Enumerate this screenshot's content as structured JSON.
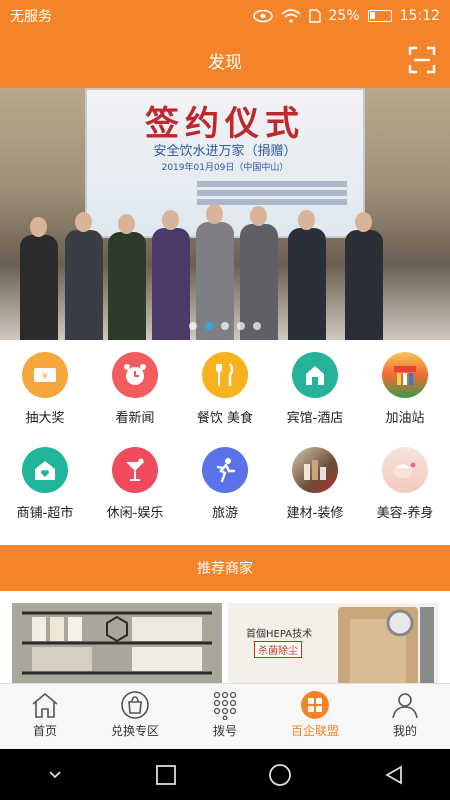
{
  "status_bar": {
    "carrier": "无服务",
    "battery": "25%",
    "time": "15:12"
  },
  "header": {
    "title": "发现"
  },
  "banner": {
    "title": "签约仪式",
    "subtitle": "安全饮水进万家（捐赠）",
    "date": "2019年01月09日（中国中山）",
    "slide_count": 5,
    "active_slide": 1
  },
  "categories": [
    {
      "label": "抽大奖",
      "icon": "ticket-icon",
      "color": "#f5a63c"
    },
    {
      "label": "看新闻",
      "icon": "alarm-clock-icon",
      "color": "#f25c5c"
    },
    {
      "label": "餐饮 美食",
      "icon": "fork-knife-icon",
      "color": "#f7b21d"
    },
    {
      "label": "宾馆-酒店",
      "icon": "hotel-building-icon",
      "color": "#26b39a"
    },
    {
      "label": "加油站",
      "icon": "gas-station-photo-icon",
      "color": "#f06a2f"
    },
    {
      "label": "商铺-超市",
      "icon": "store-house-icon",
      "color": "#1fb59a"
    },
    {
      "label": "休闲-娱乐",
      "icon": "cocktail-icon",
      "color": "#f04a5c"
    },
    {
      "label": "旅游",
      "icon": "runner-icon",
      "color": "#5a73e8"
    },
    {
      "label": "建材-装修",
      "icon": "building-materials-photo-icon",
      "color": "#8a6d58"
    },
    {
      "label": "美容-养身",
      "icon": "spa-face-photo-icon",
      "color": "#f3c9bf"
    }
  ],
  "section": {
    "title": "推荐商家"
  },
  "merchants": [
    {
      "caption": ""
    },
    {
      "hepa_text": "首個HEPA技术",
      "tag": "杀菌除尘"
    }
  ],
  "tabbar": [
    {
      "label": "首页",
      "icon": "home-icon",
      "active": false
    },
    {
      "label": "兑换专区",
      "icon": "exchange-bag-icon",
      "active": false
    },
    {
      "label": "拨号",
      "icon": "dialpad-icon",
      "active": false
    },
    {
      "label": "百企联盟",
      "icon": "alliance-grid-icon",
      "active": true
    },
    {
      "label": "我的",
      "icon": "profile-icon",
      "active": false
    }
  ],
  "colors": {
    "accent": "#f4842a",
    "indicator": "#2ea9e3"
  }
}
